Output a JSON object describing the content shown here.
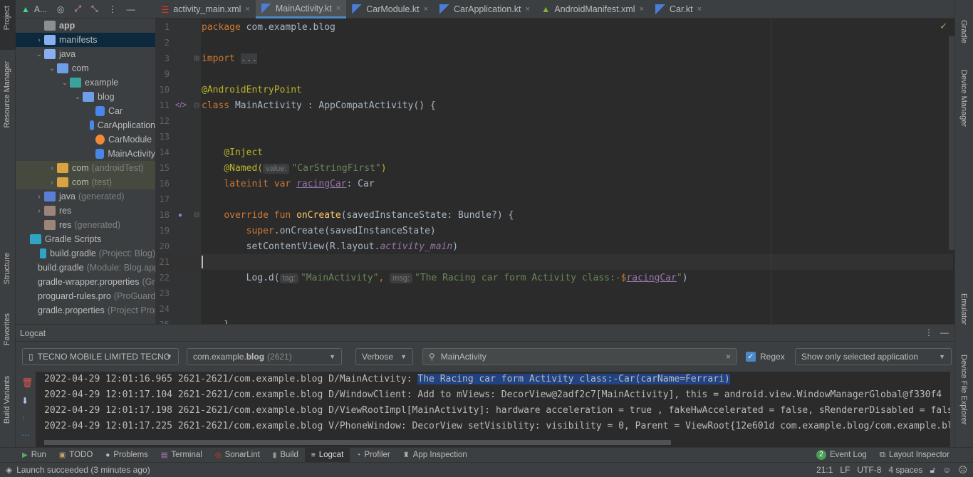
{
  "left_strip": {
    "items": [
      "Project",
      "Resource Manager",
      "Structure",
      "Favorites",
      "Build Variants"
    ]
  },
  "right_strip": {
    "items": [
      "Gradle",
      "Device Manager",
      "Emulator",
      "Device File Explorer"
    ]
  },
  "project": {
    "view_label": "A...",
    "tree": [
      {
        "label": "app",
        "suffix": "",
        "depth": 0,
        "chev": "",
        "icon": "module-folder-icon",
        "color": "#8a8f94",
        "bold": true
      },
      {
        "label": "manifests",
        "suffix": "",
        "depth": 0,
        "chev": "›",
        "icon": "folder-icon",
        "color": "#88b0f0",
        "selected": true
      },
      {
        "label": "java",
        "suffix": "",
        "depth": 0,
        "chev": "⌄",
        "icon": "folder-icon",
        "color": "#88b0f0"
      },
      {
        "label": "com",
        "suffix": "",
        "depth": 1,
        "chev": "⌄",
        "icon": "package-icon",
        "color": "#6f9ee8"
      },
      {
        "label": "example",
        "suffix": "",
        "depth": 2,
        "chev": "⌄",
        "icon": "package-icon",
        "color": "#3aa39a"
      },
      {
        "label": "blog",
        "suffix": "",
        "depth": 3,
        "chev": "⌄",
        "icon": "package-icon",
        "color": "#6f9ee8"
      },
      {
        "label": "Car",
        "suffix": "",
        "depth": 4,
        "chev": "",
        "icon": "kotlin-class-icon",
        "color": "#4a86e8"
      },
      {
        "label": "CarApplication",
        "suffix": "",
        "depth": 4,
        "chev": "",
        "icon": "kotlin-class-icon",
        "color": "#4a86e8"
      },
      {
        "label": "CarModule",
        "suffix": "",
        "depth": 4,
        "chev": "",
        "icon": "kotlin-object-icon",
        "color": "#f08a38"
      },
      {
        "label": "MainActivity",
        "suffix": "",
        "depth": 4,
        "chev": "",
        "icon": "kotlin-class-icon",
        "color": "#4a86e8"
      },
      {
        "label": "com",
        "suffix": "(androidTest)",
        "depth": 1,
        "chev": "›",
        "icon": "test-package-icon",
        "color": "#d9a343",
        "olive": true
      },
      {
        "label": "com",
        "suffix": "(test)",
        "depth": 1,
        "chev": "›",
        "icon": "test-package-icon",
        "color": "#d9a343",
        "olive": true
      },
      {
        "label": "java",
        "suffix": "(generated)",
        "depth": 0,
        "chev": "›",
        "icon": "generated-folder-icon",
        "color": "#5a7ed6"
      },
      {
        "label": "res",
        "suffix": "",
        "depth": 0,
        "chev": "›",
        "icon": "res-folder-icon",
        "color": "#9c8578"
      },
      {
        "label": "res",
        "suffix": "(generated)",
        "depth": 0,
        "chev": "",
        "icon": "res-folder-icon",
        "color": "#9c8578"
      },
      {
        "label": "Gradle Scripts",
        "suffix": "",
        "depth": -1,
        "chev": "",
        "icon": "gradle-icon",
        "color": "#2ea5c7"
      },
      {
        "label": "build.gradle",
        "suffix": "(Project: Blog)",
        "depth": 0,
        "chev": "",
        "icon": "gradle-icon",
        "color": "#2ea5c7"
      },
      {
        "label": "build.gradle",
        "suffix": "(Module: Blog.app)",
        "depth": 0,
        "chev": "",
        "icon": "gradle-icon",
        "color": "#2ea5c7"
      },
      {
        "label": "gradle-wrapper.properties",
        "suffix": "(Gradle Version)",
        "depth": 0,
        "chev": "",
        "icon": "properties-icon",
        "color": "#9ab8c8"
      },
      {
        "label": "proguard-rules.pro",
        "suffix": "(ProGuard Rules)",
        "depth": 0,
        "chev": "",
        "icon": "proguard-icon",
        "color": "#d9342b"
      },
      {
        "label": "gradle.properties",
        "suffix": "(Project Properties)",
        "depth": 0,
        "chev": "",
        "icon": "properties-icon",
        "color": "#9ab8c8"
      }
    ]
  },
  "tabs": [
    {
      "label": "activity_main.xml",
      "icon": "layout-xml-icon",
      "active": false
    },
    {
      "label": "MainActivity.kt",
      "icon": "kotlin-file-icon",
      "active": true
    },
    {
      "label": "CarModule.kt",
      "icon": "kotlin-file-icon",
      "active": false
    },
    {
      "label": "CarApplication.kt",
      "icon": "kotlin-file-icon",
      "active": false
    },
    {
      "label": "AndroidManifest.xml",
      "icon": "android-icon",
      "active": false
    },
    {
      "label": "Car.kt",
      "icon": "kotlin-file-icon",
      "active": false
    }
  ],
  "editor": {
    "current_line": "21",
    "lines": [
      {
        "n": "1",
        "t": [
          [
            "kw",
            "package "
          ],
          [
            "",
            "com.example.blog"
          ]
        ]
      },
      {
        "n": "2",
        "t": []
      },
      {
        "n": "3",
        "t": [
          [
            "kw",
            "import "
          ],
          [
            "fold",
            "..."
          ]
        ]
      },
      {
        "n": "9",
        "t": []
      },
      {
        "n": "10",
        "t": [
          [
            "ann",
            "@AndroidEntryPoint"
          ]
        ]
      },
      {
        "n": "11",
        "t": [
          [
            "kw",
            "class "
          ],
          [
            "",
            "MainActivity : AppCompatActivity() {"
          ]
        ]
      },
      {
        "n": "12",
        "t": []
      },
      {
        "n": "13",
        "t": []
      },
      {
        "n": "14",
        "t": [
          [
            "",
            "    "
          ],
          [
            "ann",
            "@Inject"
          ]
        ]
      },
      {
        "n": "15",
        "t": [
          [
            "",
            "    "
          ],
          [
            "ann",
            "@Named("
          ],
          [
            "hint",
            "value:"
          ],
          [
            "str",
            "\"CarStringFirst\""
          ],
          [
            "ann",
            ")"
          ]
        ]
      },
      {
        "n": "16",
        "t": [
          [
            "",
            "    "
          ],
          [
            "kw",
            "lateinit var "
          ],
          [
            "prop",
            "racingCar"
          ],
          [
            "",
            ": Car"
          ]
        ]
      },
      {
        "n": "17",
        "t": []
      },
      {
        "n": "18",
        "t": [
          [
            "",
            "    "
          ],
          [
            "kw",
            "override fun "
          ],
          [
            "fn",
            "onCreate"
          ],
          [
            "",
            "(savedInstanceState: Bundle?) {"
          ]
        ]
      },
      {
        "n": "19",
        "t": [
          [
            "",
            "        "
          ],
          [
            "kw",
            "super"
          ],
          [
            "",
            ".onCreate(savedInstanceState)"
          ]
        ]
      },
      {
        "n": "20",
        "t": [
          [
            "",
            "        setContentView(R.layout."
          ],
          [
            "it",
            "activity_main"
          ],
          [
            "",
            ")"
          ]
        ]
      },
      {
        "n": "21",
        "t": []
      },
      {
        "n": "22",
        "t": [
          [
            "",
            "        Log.d("
          ],
          [
            "hint",
            "tag:"
          ],
          [
            "str",
            "\"MainActivity\""
          ],
          [
            "kw",
            ", "
          ],
          [
            "hint",
            "msg:"
          ],
          [
            "str",
            "\"The Racing car form Activity class:-"
          ],
          [
            "kw",
            "$"
          ],
          [
            "prop",
            "racingCar"
          ],
          [
            "str",
            "\""
          ],
          [
            "",
            ")"
          ]
        ]
      },
      {
        "n": "23",
        "t": []
      },
      {
        "n": "24",
        "t": []
      },
      {
        "n": "25",
        "t": [
          [
            "",
            "    }"
          ]
        ]
      }
    ]
  },
  "logcat": {
    "title": "Logcat",
    "device": "TECNO MOBILE LIMITED TECNO",
    "process_prefix": "com.example.",
    "process_bold": "blog",
    "process_pid": "(2621)",
    "level": "Verbose",
    "search_value": "MainActivity",
    "regex_label": "Regex",
    "regex_checked": true,
    "filter": "Show only selected application",
    "lines": [
      {
        "prefix": "2022-04-29 12:01:16.965 2621-2621/com.example.blog D/MainActivity: ",
        "highlight": "The Racing car form Activity class:-Car(carName=Ferrari)"
      },
      {
        "prefix": "2022-04-29 12:01:17.104 2621-2621/com.example.blog D/WindowClient: Add to mViews: DecorView@2adf2c7[MainActivity], this = android.view.WindowManagerGlobal@f330f4",
        "highlight": ""
      },
      {
        "prefix": "2022-04-29 12:01:17.198 2621-2621/com.example.blog D/ViewRootImpl[MainActivity]: hardware acceleration = true , fakeHwAccelerated = false, sRendererDisabled = false",
        "highlight": ""
      },
      {
        "prefix": "2022-04-29 12:01:17.225 2621-2621/com.example.blog V/PhoneWindow: DecorView setVisiblity: visibility = 0, Parent = ViewRoot{12e601d com.example.blog/com.example.blog.MainActivity}",
        "highlight": ""
      }
    ]
  },
  "tool_tabs": [
    {
      "label": "Run",
      "icon": "run-icon",
      "color": "#59a869"
    },
    {
      "label": "TODO",
      "icon": "todo-icon",
      "color": "#c9a26d"
    },
    {
      "label": "Problems",
      "icon": "problems-icon",
      "color": "#bbbbbb"
    },
    {
      "label": "Terminal",
      "icon": "terminal-icon",
      "color": "#b07cc6"
    },
    {
      "label": "SonarLint",
      "icon": "sonarlint-icon",
      "color": "#d9342b"
    },
    {
      "label": "Build",
      "icon": "build-icon",
      "color": "#999999"
    },
    {
      "label": "Logcat",
      "icon": "logcat-icon",
      "color": "#dddddd",
      "active": true
    },
    {
      "label": "Profiler",
      "icon": "profiler-icon",
      "color": "#bbbbbb"
    },
    {
      "label": "App Inspection",
      "icon": "app-inspection-icon",
      "color": "#bbbbbb"
    }
  ],
  "tool_tabs_right": {
    "event_log_count": "2",
    "event_log": "Event Log",
    "layout_inspector": "Layout Inspector"
  },
  "status": {
    "message": "Launch succeeded (3 minutes ago)",
    "position": "21:1",
    "line_sep": "LF",
    "encoding": "UTF-8",
    "indent": "4 spaces"
  }
}
